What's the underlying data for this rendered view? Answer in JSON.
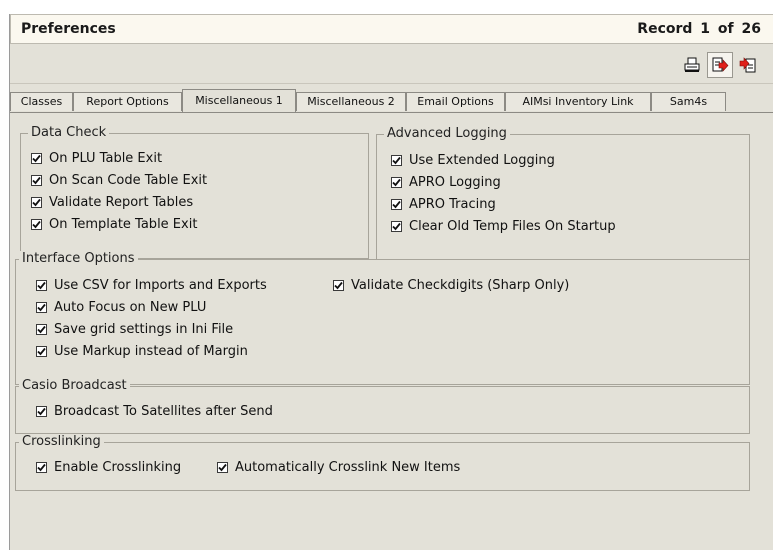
{
  "header": {
    "title": "Preferences",
    "record_label": "Record",
    "record_current": "1",
    "record_of": "of",
    "record_total": "26"
  },
  "toolbar": {
    "buttons": [
      {
        "icon": "printer-icon"
      },
      {
        "icon": "export-arrow-icon"
      },
      {
        "icon": "import-document-icon"
      }
    ]
  },
  "tabs": [
    {
      "label": "Classes"
    },
    {
      "label": "Report Options"
    },
    {
      "label": "Miscellaneous 1",
      "active": true
    },
    {
      "label": "Miscellaneous 2"
    },
    {
      "label": "Email Options"
    },
    {
      "label": "AIMsi Inventory Link"
    },
    {
      "label": "Sam4s"
    }
  ],
  "groups": {
    "data_check": {
      "title": "Data Check",
      "items": [
        {
          "label": "On PLU Table Exit",
          "checked": true
        },
        {
          "label": "On Scan Code Table Exit",
          "checked": true
        },
        {
          "label": "Validate Report Tables",
          "checked": true
        },
        {
          "label": "On Template Table Exit",
          "checked": true
        }
      ]
    },
    "advanced_logging": {
      "title": "Advanced Logging",
      "items": [
        {
          "label": "Use Extended Logging",
          "checked": true
        },
        {
          "label": "APRO Logging",
          "checked": true
        },
        {
          "label": "APRO Tracing",
          "checked": true
        },
        {
          "label": "Clear Old Temp Files On Startup",
          "checked": true
        }
      ]
    },
    "interface_options": {
      "title": "Interface Options",
      "items": [
        {
          "label": "Use CSV for Imports and Exports",
          "checked": true
        },
        {
          "label": "Auto Focus on New PLU",
          "checked": true
        },
        {
          "label": "Save grid settings in Ini File",
          "checked": true
        },
        {
          "label": "Use Markup instead of Margin",
          "checked": true
        },
        {
          "label": "Validate Checkdigits (Sharp Only)",
          "checked": true
        }
      ]
    },
    "casio_broadcast": {
      "title": "Casio Broadcast",
      "items": [
        {
          "label": "Broadcast To Satellites after Send",
          "checked": true
        }
      ]
    },
    "crosslinking": {
      "title": "Crosslinking",
      "items": [
        {
          "label": "Enable Crosslinking",
          "checked": true
        },
        {
          "label": "Automatically Crosslink New Items",
          "checked": true
        }
      ]
    }
  }
}
